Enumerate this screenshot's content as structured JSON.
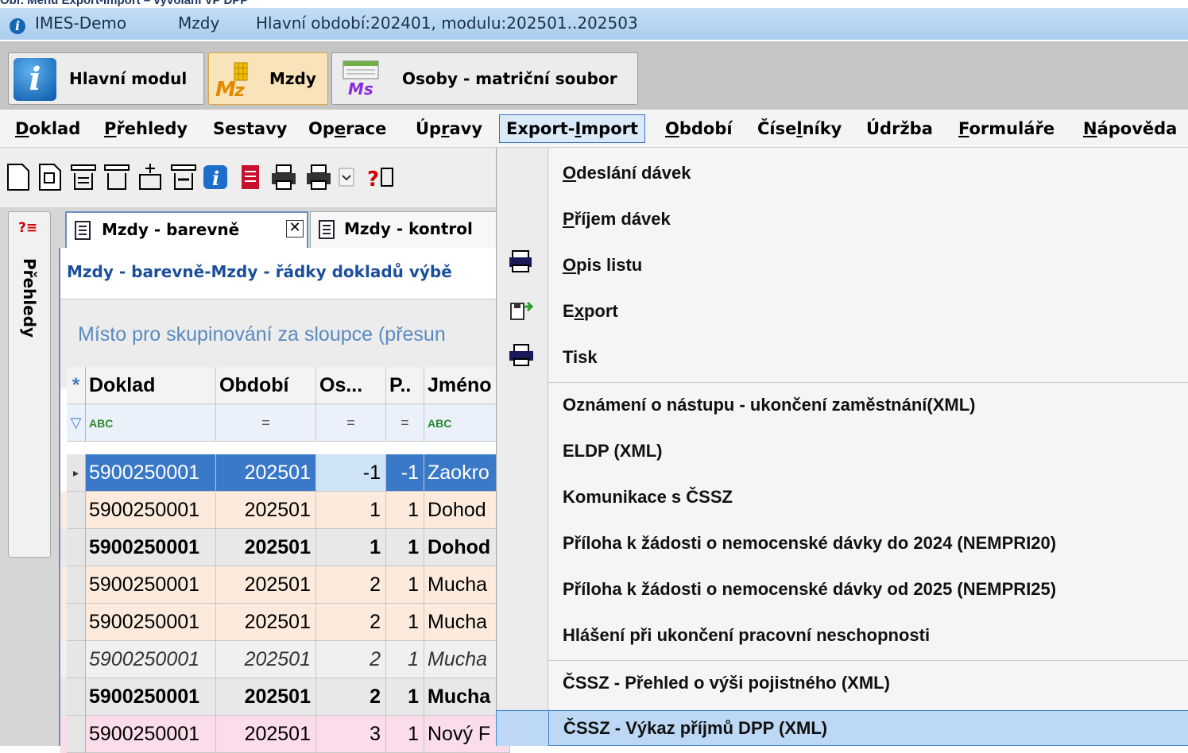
{
  "caption": "Obr. Menu Export-Import – vyvolání VP DPP",
  "window": {
    "app": "IMES-Demo",
    "module": "Mzdy",
    "period": "Hlavní období:202401, modulu:202501..202503"
  },
  "modules": [
    {
      "label": "Hlavní modul",
      "icon": "info-icon"
    },
    {
      "label": "Mzdy",
      "icon": "mzdy-module-icon"
    },
    {
      "label": "Osoby - matriční soubor",
      "icon": "osoby-module-icon"
    }
  ],
  "menubar": {
    "doklad": {
      "pre": "",
      "u": "D",
      "post": "oklad"
    },
    "prehledy": {
      "pre": "",
      "u": "P",
      "post": "řehledy"
    },
    "sestavy": {
      "pre": "Sestavy",
      "u": "",
      "post": ""
    },
    "operace": {
      "pre": "Op",
      "u": "e",
      "post": "race"
    },
    "upravy": {
      "pre": "Úp",
      "u": "r",
      "post": "avy"
    },
    "export": {
      "pre": "Export-",
      "u": "I",
      "post": "mport"
    },
    "obdobi": {
      "pre": "",
      "u": "O",
      "post": "bdobí"
    },
    "ciselniky": {
      "pre": "Číse",
      "u": "l",
      "post": "níky"
    },
    "udrzba": {
      "pre": "Údržba",
      "u": "",
      "post": ""
    },
    "formulare": {
      "pre": "",
      "u": "F",
      "post": "ormuláře"
    },
    "napoveda": {
      "pre": "",
      "u": "N",
      "post": "ápověda"
    }
  },
  "side_tab": {
    "label": "Přehledy"
  },
  "doc_tabs": [
    {
      "label": "Mzdy - barevně",
      "close": "✕"
    },
    {
      "label": "Mzdy - kontrol"
    }
  ],
  "grid": {
    "title": "Mzdy - barevně-Mzdy - řádky dokladů výbě",
    "group_hint": "Místo pro skupinování za sloupce (přesun",
    "headers": {
      "doklad": "Doklad",
      "obdobi": "Období",
      "os": "Os...",
      "p": "P..",
      "jmeno": "Jméno"
    },
    "filters": {
      "abc": "ABC",
      "eq": "="
    },
    "rows": [
      {
        "doklad": "5900250001",
        "obdobi": "202501",
        "os": "-1",
        "p": "-1",
        "jmeno": "Zaokro"
      },
      {
        "doklad": "5900250001",
        "obdobi": "202501",
        "os": "1",
        "p": "1",
        "jmeno": "Dohod"
      },
      {
        "doklad": "5900250001",
        "obdobi": "202501",
        "os": "1",
        "p": "1",
        "jmeno": "Dohod"
      },
      {
        "doklad": "5900250001",
        "obdobi": "202501",
        "os": "2",
        "p": "1",
        "jmeno": "Mucha"
      },
      {
        "doklad": "5900250001",
        "obdobi": "202501",
        "os": "2",
        "p": "1",
        "jmeno": "Mucha"
      },
      {
        "doklad": "5900250001",
        "obdobi": "202501",
        "os": "2",
        "p": "1",
        "jmeno": "Mucha"
      },
      {
        "doklad": "5900250001",
        "obdobi": "202501",
        "os": "2",
        "p": "1",
        "jmeno": "Mucha"
      },
      {
        "doklad": "5900250001",
        "obdobi": "202501",
        "os": "3",
        "p": "1",
        "jmeno": "Nový F"
      }
    ]
  },
  "export_menu": {
    "odeslani": {
      "pre": "",
      "u": "O",
      "post": "deslání dávek"
    },
    "prijem": {
      "pre": "",
      "u": "P",
      "post": "říjem dávek"
    },
    "opis": {
      "pre": "",
      "u": "O",
      "post": "pis listu"
    },
    "export": {
      "pre": "E",
      "u": "x",
      "post": "port"
    },
    "tisk": "Tisk",
    "oznameni": "Oznámení o nástupu - ukončení zaměstnání(XML)",
    "eldp": "ELDP (XML)",
    "komunikace": "Komunikace s ČSSZ",
    "nempri20": "Příloha k žádosti o nemocenské dávky do 2024 (NEMPRI20)",
    "nempri25": "Příloha k žádosti o nemocenské dávky od 2025 (NEMPRI25)",
    "hlaseni": "Hlášení při ukončení pracovní neschopnosti",
    "prehled_pojistneho": "ČSSZ - Přehled o výši pojistného (XML)",
    "vykaz_dpp": "ČSSZ - Výkaz příjmů DPP (XML)"
  },
  "colors": {
    "selection": "#3a78c8",
    "menu_highlight": "#bcd8f4",
    "row_beige": "#fcebdc",
    "row_pink": "#fadcea",
    "row_gray": "#e8e8e8"
  }
}
